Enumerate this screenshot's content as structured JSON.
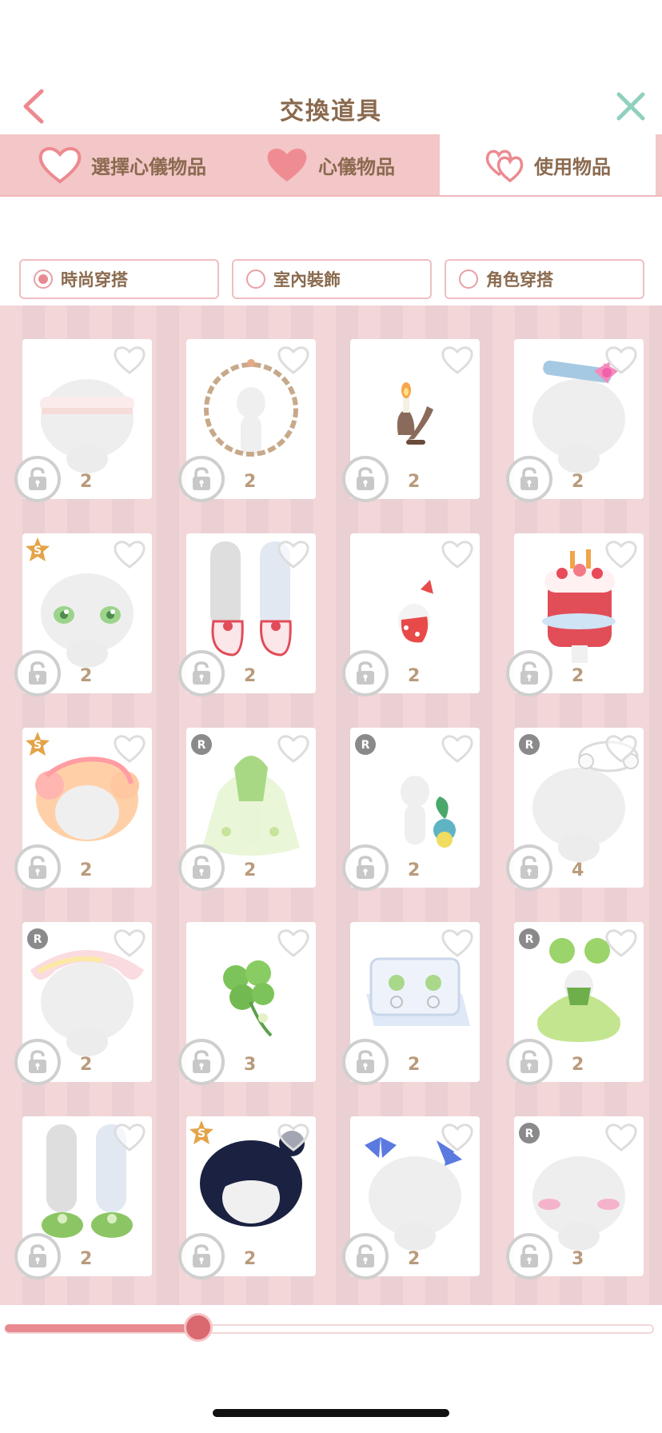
{
  "header": {
    "title": "交換道具",
    "back_icon": "chevron-left-icon",
    "close_icon": "close-icon"
  },
  "tabs": [
    {
      "label": "選擇心儀物品",
      "icon": "heart-outline-icon"
    },
    {
      "label": "心儀物品",
      "icon": "heart-filled-icon"
    },
    {
      "label": "使用物品",
      "icon": "double-heart-icon",
      "active": true
    }
  ],
  "filters": [
    {
      "label": "時尚穿搭",
      "selected": true
    },
    {
      "label": "室內裝飾",
      "selected": false
    },
    {
      "label": "角色穿搭",
      "selected": false
    }
  ],
  "items": [
    {
      "count": "2",
      "badge": "",
      "art": "lace-headband"
    },
    {
      "count": "2",
      "badge": "",
      "art": "branch-wreath"
    },
    {
      "count": "2",
      "badge": "",
      "art": "candle-holder"
    },
    {
      "count": "2",
      "badge": "",
      "art": "blue-bow-headband"
    },
    {
      "count": "2",
      "badge": "S",
      "art": "green-eyes"
    },
    {
      "count": "2",
      "badge": "",
      "art": "red-boots"
    },
    {
      "count": "2",
      "badge": "",
      "art": "bunny-charm"
    },
    {
      "count": "2",
      "badge": "",
      "art": "cake-dress"
    },
    {
      "count": "2",
      "badge": "S",
      "art": "peach-curly-hair"
    },
    {
      "count": "2",
      "badge": "R",
      "art": "green-gown"
    },
    {
      "count": "2",
      "badge": "R",
      "art": "sprout-pet"
    },
    {
      "count": "4",
      "badge": "R",
      "art": "white-headpiece"
    },
    {
      "count": "2",
      "badge": "R",
      "art": "pink-hat"
    },
    {
      "count": "3",
      "badge": "",
      "art": "clover-item"
    },
    {
      "count": "2",
      "badge": "",
      "art": "earring-box"
    },
    {
      "count": "2",
      "badge": "R",
      "art": "green-puff-dress"
    },
    {
      "count": "2",
      "badge": "",
      "art": "green-slippers"
    },
    {
      "count": "2",
      "badge": "S",
      "art": "navy-hair"
    },
    {
      "count": "2",
      "badge": "",
      "art": "blue-bow-clips"
    },
    {
      "count": "3",
      "badge": "R",
      "art": "pink-blush"
    }
  ],
  "slider": {
    "value": 0.3
  },
  "colors": {
    "accent": "#e88a93",
    "brown": "#8a6a4e",
    "tabbar": "#f3c6c8"
  }
}
